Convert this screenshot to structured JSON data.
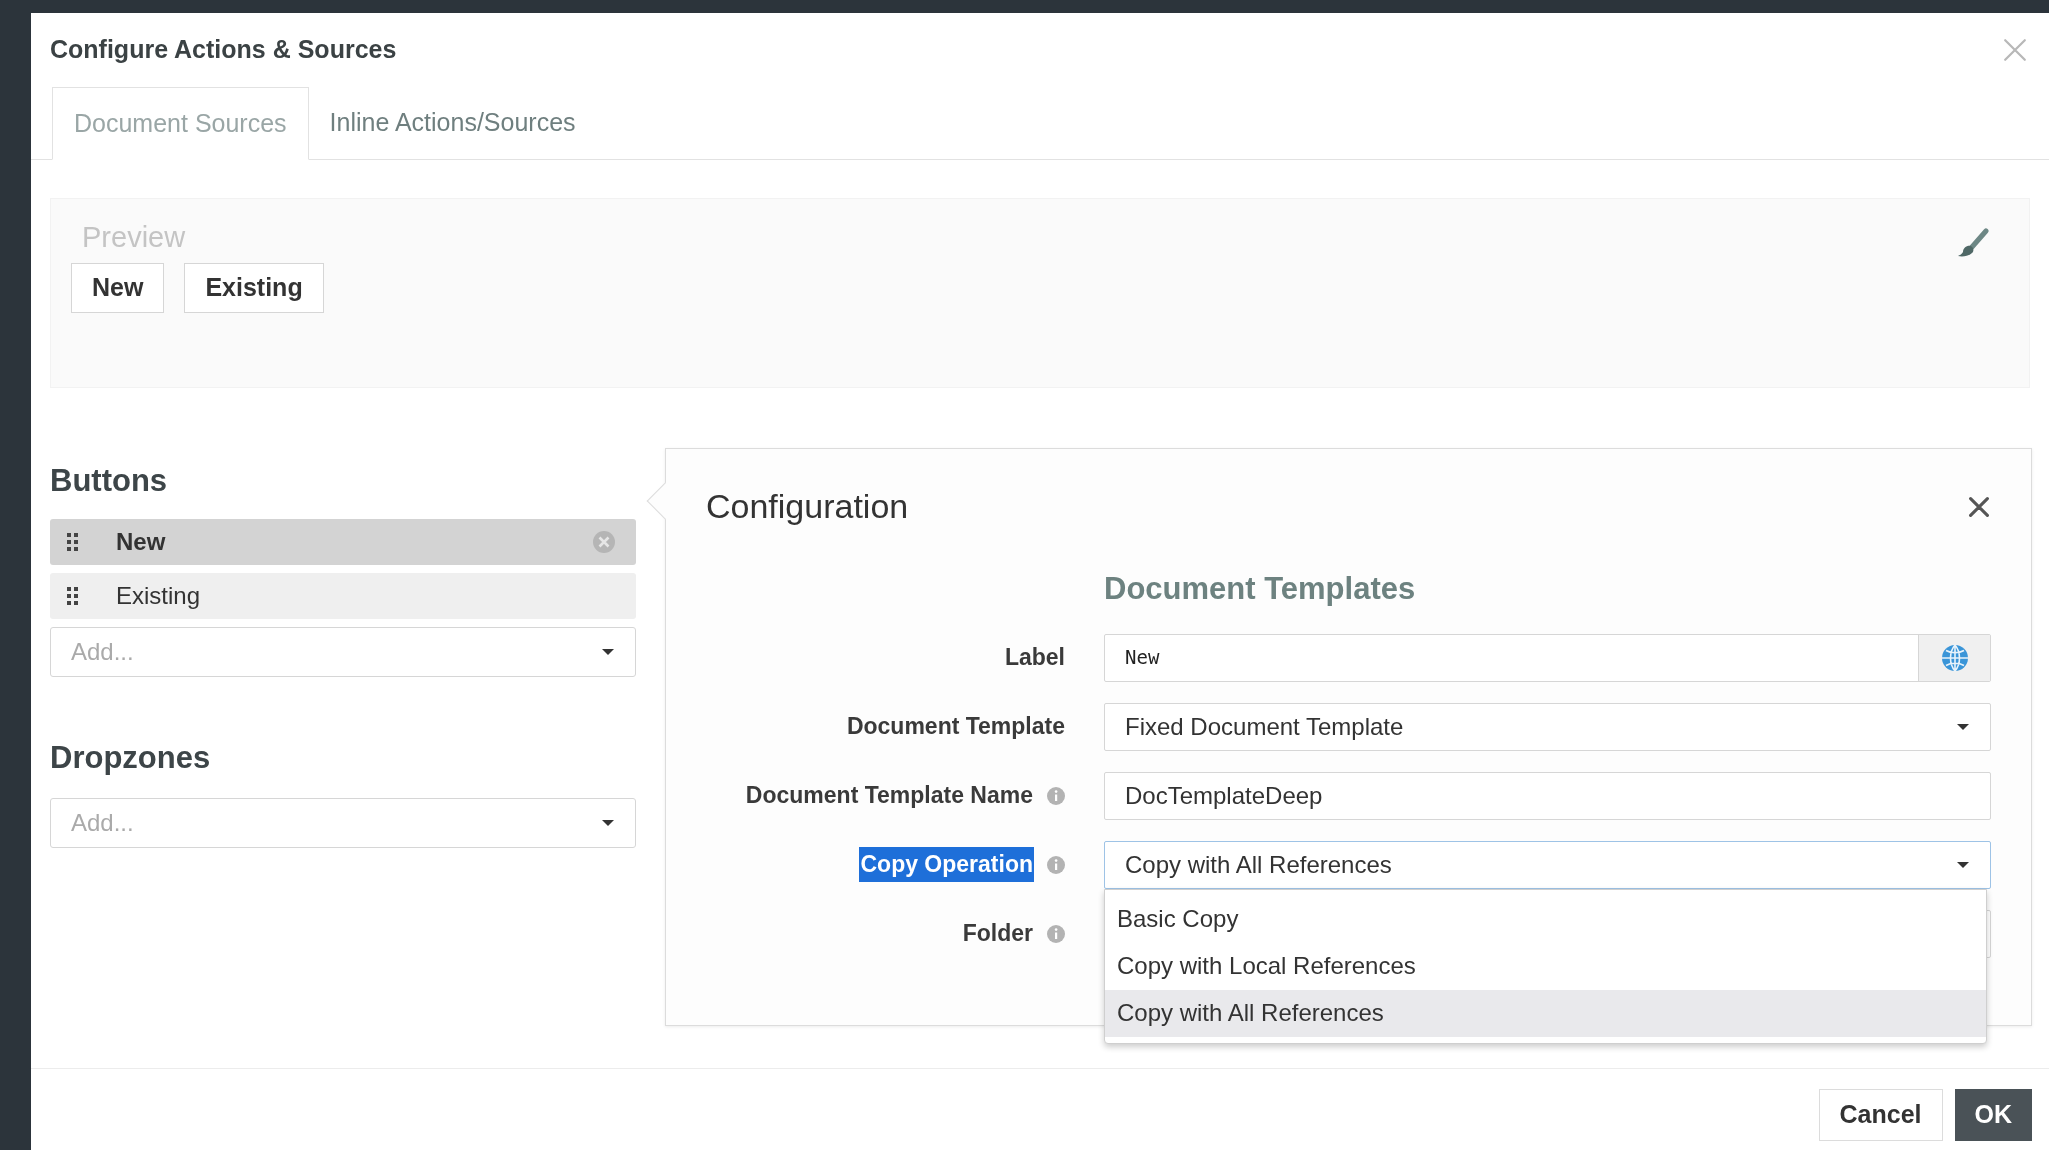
{
  "dialog": {
    "title": "Configure Actions & Sources",
    "tabs": [
      {
        "label": "Document Sources",
        "selected": true
      },
      {
        "label": "Inline Actions/Sources",
        "selected": false
      }
    ],
    "preview": {
      "title": "Preview",
      "buttons": [
        "New",
        "Existing"
      ]
    },
    "buttons_section": {
      "heading": "Buttons",
      "items": [
        {
          "label": "New",
          "selected": true
        },
        {
          "label": "Existing",
          "selected": false
        }
      ],
      "add_placeholder": "Add..."
    },
    "dropzones": {
      "heading": "Dropzones",
      "add_placeholder": "Add..."
    },
    "configuration": {
      "title": "Configuration",
      "section": "Document Templates",
      "fields": [
        {
          "kind": "text",
          "label": "Label",
          "value": "New",
          "info": false,
          "highlighted": false
        },
        {
          "kind": "select",
          "label": "Document Template",
          "value": "Fixed Document Template",
          "info": false,
          "highlighted": false
        },
        {
          "kind": "text",
          "label": "Document Template Name",
          "value": "DocTemplateDeep",
          "info": true,
          "highlighted": false
        },
        {
          "kind": "select",
          "label": "Copy Operation",
          "value": "Copy with All References",
          "info": true,
          "highlighted": true,
          "expanded": true
        },
        {
          "kind": "select",
          "label": "Folder",
          "info": true,
          "highlighted": false
        }
      ],
      "options": [
        {
          "label": "Basic Copy",
          "selected": false
        },
        {
          "label": "Copy with Local References",
          "selected": false
        },
        {
          "label": "Copy with All References",
          "selected": true
        }
      ]
    },
    "footer": [
      {
        "label": "Cancel",
        "kind": "secondary"
      },
      {
        "label": "OK",
        "kind": "primary"
      }
    ]
  }
}
